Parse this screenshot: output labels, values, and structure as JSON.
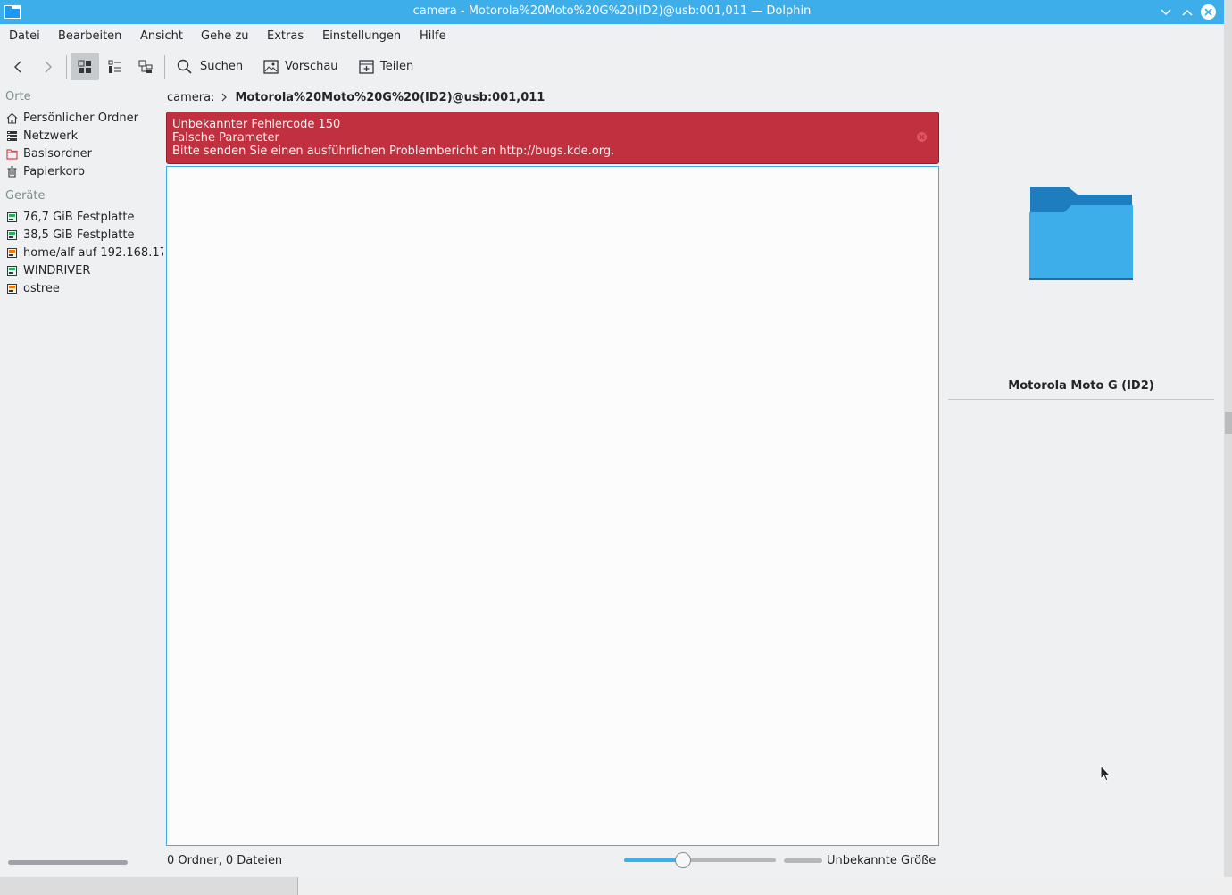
{
  "window": {
    "title": "camera - Motorola%20Moto%20G%20(ID2)@usb:001,011 — Dolphin",
    "controls": [
      "minimize-icon",
      "maximize-icon",
      "close-icon"
    ]
  },
  "menu": [
    "Datei",
    "Bearbeiten",
    "Ansicht",
    "Gehe zu",
    "Extras",
    "Einstellungen",
    "Hilfe"
  ],
  "toolbar": {
    "back_icon": "chevron-left-icon",
    "forward_icon": "chevron-right-icon",
    "view_modes": [
      "icons-view-icon",
      "compact-view-icon",
      "details-view-icon"
    ],
    "search_label": "Suchen",
    "preview_label": "Vorschau",
    "share_label": "Teilen"
  },
  "sidebar": {
    "places_header": "Orte",
    "places": [
      {
        "label": "Persönlicher Ordner",
        "icon": "home-icon"
      },
      {
        "label": "Netzwerk",
        "icon": "network-icon"
      },
      {
        "label": "Basisordner",
        "icon": "root-folder-icon"
      },
      {
        "label": "Papierkorb",
        "icon": "trash-icon"
      }
    ],
    "devices_header": "Geräte",
    "devices": [
      {
        "label": "76,7 GiB Festplatte",
        "icon": "harddisk-icon"
      },
      {
        "label": "38,5 GiB Festplatte",
        "icon": "harddisk-icon"
      },
      {
        "label": "home/alf auf 192.168.17",
        "icon": "network-drive-icon"
      },
      {
        "label": "WINDRIVER",
        "icon": "harddisk-icon"
      },
      {
        "label": "ostree",
        "icon": "network-drive-icon"
      }
    ]
  },
  "breadcrumb": {
    "root": "camera:",
    "separator_icon": "chevron-right-icon",
    "current": "Motorola%20Moto%20G%20(ID2)@usb:001,011"
  },
  "error": {
    "line1": "Unbekannter Fehlercode 150",
    "line2": "Falsche Parameter",
    "line3": "Bitte senden Sie einen ausführlichen Problembericht an http://bugs.kde.org."
  },
  "status": {
    "summary": "0 Ordner, 0 Dateien",
    "zoom_fraction": 0.39,
    "space_text": "Unbekannte Größe"
  },
  "info": {
    "name": "Motorola Moto G (ID2)",
    "icon": "folder-icon"
  },
  "colors": {
    "accent": "#3daee9",
    "error": "#c0303e"
  }
}
